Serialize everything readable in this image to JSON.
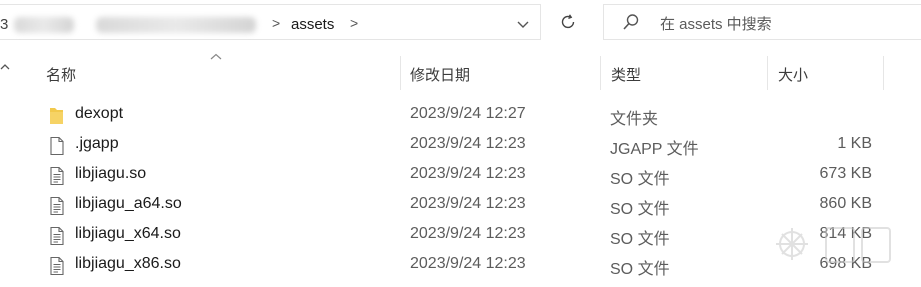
{
  "address_bar": {
    "path_first_char": "3",
    "current_folder": "assets",
    "separator": ">",
    "dropdown_icon": "chevron-down-icon",
    "refresh_icon": "refresh-icon"
  },
  "search": {
    "placeholder": "在 assets 中搜索",
    "icon": "search-icon"
  },
  "columns": {
    "name": "名称",
    "date": "修改日期",
    "type": "类型",
    "size": "大小"
  },
  "files": [
    {
      "name": "dexopt",
      "date": "2023/9/24 12:27",
      "type": "文件夹",
      "size": "",
      "icon": "folder-icon"
    },
    {
      "name": ".jgapp",
      "date": "2023/9/24 12:23",
      "type": "JGAPP 文件",
      "size": "1 KB",
      "icon": "file-icon"
    },
    {
      "name": "libjiagu.so",
      "date": "2023/9/24 12:23",
      "type": "SO 文件",
      "size": "673 KB",
      "icon": "text-file-icon"
    },
    {
      "name": "libjiagu_a64.so",
      "date": "2023/9/24 12:23",
      "type": "SO 文件",
      "size": "860 KB",
      "icon": "text-file-icon"
    },
    {
      "name": "libjiagu_x64.so",
      "date": "2023/9/24 12:23",
      "type": "SO 文件",
      "size": "814 KB",
      "icon": "text-file-icon"
    },
    {
      "name": "libjiagu_x86.so",
      "date": "2023/9/24 12:23",
      "type": "SO 文件",
      "size": "698 KB",
      "icon": "text-file-icon"
    }
  ],
  "colors": {
    "folder": "#f2c94c",
    "border": "#e5e5e5",
    "muted_text": "#5c5c5c"
  }
}
